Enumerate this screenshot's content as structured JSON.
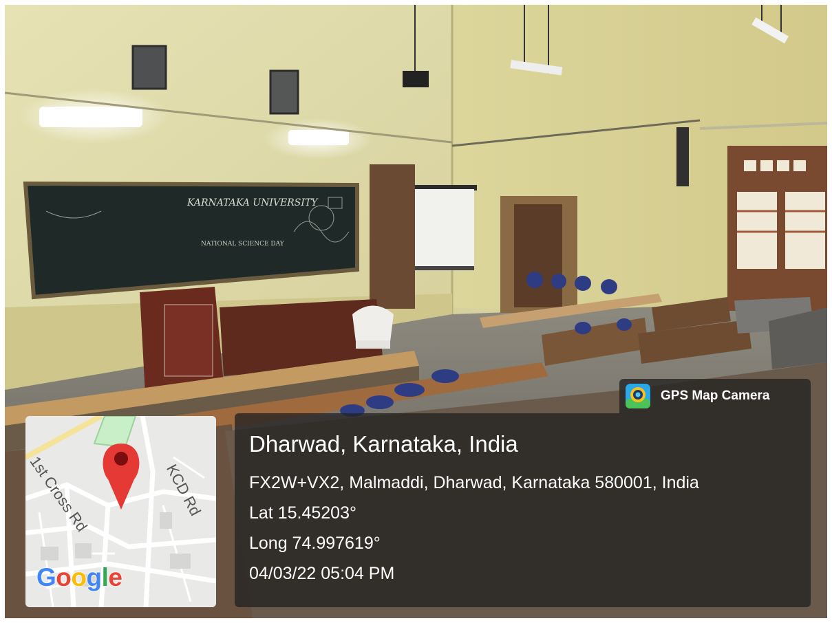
{
  "overlay": {
    "app_badge": {
      "label": "GPS Map Camera",
      "icon": "gps-map-camera-app-icon"
    },
    "location": {
      "title": "Dharwad, Karnataka, India",
      "address": "FX2W+VX2, Malmaddi, Dharwad, Karnataka 580001, India",
      "latitude": "Lat 15.45203°",
      "longitude": "Long 74.997619°",
      "datetime": "04/03/22 05:04 PM"
    },
    "map": {
      "road_labels": [
        "KCD Rd",
        "1st Cross Rd"
      ],
      "logo": "Google",
      "marker_icon": "map-pin-icon"
    }
  },
  "scene": {
    "blackboard_text": [
      "KARNATAKA UNIVERSITY",
      "NATIONAL SCIENCE DAY"
    ]
  },
  "colors": {
    "overlay_bg": "#222222",
    "wall": "#d9d39a",
    "pin": "#e53935",
    "google_blue": "#4285F4",
    "google_red": "#EA4335",
    "google_yellow": "#FBBC05",
    "google_green": "#34A853"
  }
}
